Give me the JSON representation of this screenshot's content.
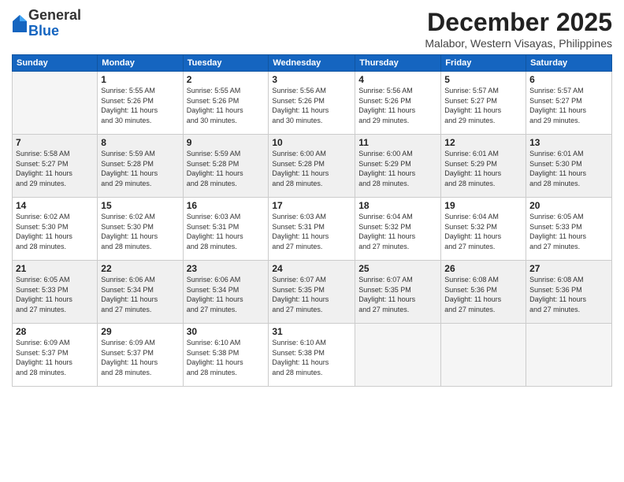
{
  "header": {
    "logo_general": "General",
    "logo_blue": "Blue",
    "month": "December 2025",
    "location": "Malabor, Western Visayas, Philippines"
  },
  "weekdays": [
    "Sunday",
    "Monday",
    "Tuesday",
    "Wednesday",
    "Thursday",
    "Friday",
    "Saturday"
  ],
  "weeks": [
    [
      {
        "day": "",
        "info": ""
      },
      {
        "day": "1",
        "info": "Sunrise: 5:55 AM\nSunset: 5:26 PM\nDaylight: 11 hours\nand 30 minutes."
      },
      {
        "day": "2",
        "info": "Sunrise: 5:55 AM\nSunset: 5:26 PM\nDaylight: 11 hours\nand 30 minutes."
      },
      {
        "day": "3",
        "info": "Sunrise: 5:56 AM\nSunset: 5:26 PM\nDaylight: 11 hours\nand 30 minutes."
      },
      {
        "day": "4",
        "info": "Sunrise: 5:56 AM\nSunset: 5:26 PM\nDaylight: 11 hours\nand 29 minutes."
      },
      {
        "day": "5",
        "info": "Sunrise: 5:57 AM\nSunset: 5:27 PM\nDaylight: 11 hours\nand 29 minutes."
      },
      {
        "day": "6",
        "info": "Sunrise: 5:57 AM\nSunset: 5:27 PM\nDaylight: 11 hours\nand 29 minutes."
      }
    ],
    [
      {
        "day": "7",
        "info": "Sunrise: 5:58 AM\nSunset: 5:27 PM\nDaylight: 11 hours\nand 29 minutes."
      },
      {
        "day": "8",
        "info": "Sunrise: 5:59 AM\nSunset: 5:28 PM\nDaylight: 11 hours\nand 29 minutes."
      },
      {
        "day": "9",
        "info": "Sunrise: 5:59 AM\nSunset: 5:28 PM\nDaylight: 11 hours\nand 28 minutes."
      },
      {
        "day": "10",
        "info": "Sunrise: 6:00 AM\nSunset: 5:28 PM\nDaylight: 11 hours\nand 28 minutes."
      },
      {
        "day": "11",
        "info": "Sunrise: 6:00 AM\nSunset: 5:29 PM\nDaylight: 11 hours\nand 28 minutes."
      },
      {
        "day": "12",
        "info": "Sunrise: 6:01 AM\nSunset: 5:29 PM\nDaylight: 11 hours\nand 28 minutes."
      },
      {
        "day": "13",
        "info": "Sunrise: 6:01 AM\nSunset: 5:30 PM\nDaylight: 11 hours\nand 28 minutes."
      }
    ],
    [
      {
        "day": "14",
        "info": "Sunrise: 6:02 AM\nSunset: 5:30 PM\nDaylight: 11 hours\nand 28 minutes."
      },
      {
        "day": "15",
        "info": "Sunrise: 6:02 AM\nSunset: 5:30 PM\nDaylight: 11 hours\nand 28 minutes."
      },
      {
        "day": "16",
        "info": "Sunrise: 6:03 AM\nSunset: 5:31 PM\nDaylight: 11 hours\nand 28 minutes."
      },
      {
        "day": "17",
        "info": "Sunrise: 6:03 AM\nSunset: 5:31 PM\nDaylight: 11 hours\nand 27 minutes."
      },
      {
        "day": "18",
        "info": "Sunrise: 6:04 AM\nSunset: 5:32 PM\nDaylight: 11 hours\nand 27 minutes."
      },
      {
        "day": "19",
        "info": "Sunrise: 6:04 AM\nSunset: 5:32 PM\nDaylight: 11 hours\nand 27 minutes."
      },
      {
        "day": "20",
        "info": "Sunrise: 6:05 AM\nSunset: 5:33 PM\nDaylight: 11 hours\nand 27 minutes."
      }
    ],
    [
      {
        "day": "21",
        "info": "Sunrise: 6:05 AM\nSunset: 5:33 PM\nDaylight: 11 hours\nand 27 minutes."
      },
      {
        "day": "22",
        "info": "Sunrise: 6:06 AM\nSunset: 5:34 PM\nDaylight: 11 hours\nand 27 minutes."
      },
      {
        "day": "23",
        "info": "Sunrise: 6:06 AM\nSunset: 5:34 PM\nDaylight: 11 hours\nand 27 minutes."
      },
      {
        "day": "24",
        "info": "Sunrise: 6:07 AM\nSunset: 5:35 PM\nDaylight: 11 hours\nand 27 minutes."
      },
      {
        "day": "25",
        "info": "Sunrise: 6:07 AM\nSunset: 5:35 PM\nDaylight: 11 hours\nand 27 minutes."
      },
      {
        "day": "26",
        "info": "Sunrise: 6:08 AM\nSunset: 5:36 PM\nDaylight: 11 hours\nand 27 minutes."
      },
      {
        "day": "27",
        "info": "Sunrise: 6:08 AM\nSunset: 5:36 PM\nDaylight: 11 hours\nand 27 minutes."
      }
    ],
    [
      {
        "day": "28",
        "info": "Sunrise: 6:09 AM\nSunset: 5:37 PM\nDaylight: 11 hours\nand 28 minutes."
      },
      {
        "day": "29",
        "info": "Sunrise: 6:09 AM\nSunset: 5:37 PM\nDaylight: 11 hours\nand 28 minutes."
      },
      {
        "day": "30",
        "info": "Sunrise: 6:10 AM\nSunset: 5:38 PM\nDaylight: 11 hours\nand 28 minutes."
      },
      {
        "day": "31",
        "info": "Sunrise: 6:10 AM\nSunset: 5:38 PM\nDaylight: 11 hours\nand 28 minutes."
      },
      {
        "day": "",
        "info": ""
      },
      {
        "day": "",
        "info": ""
      },
      {
        "day": "",
        "info": ""
      }
    ]
  ]
}
